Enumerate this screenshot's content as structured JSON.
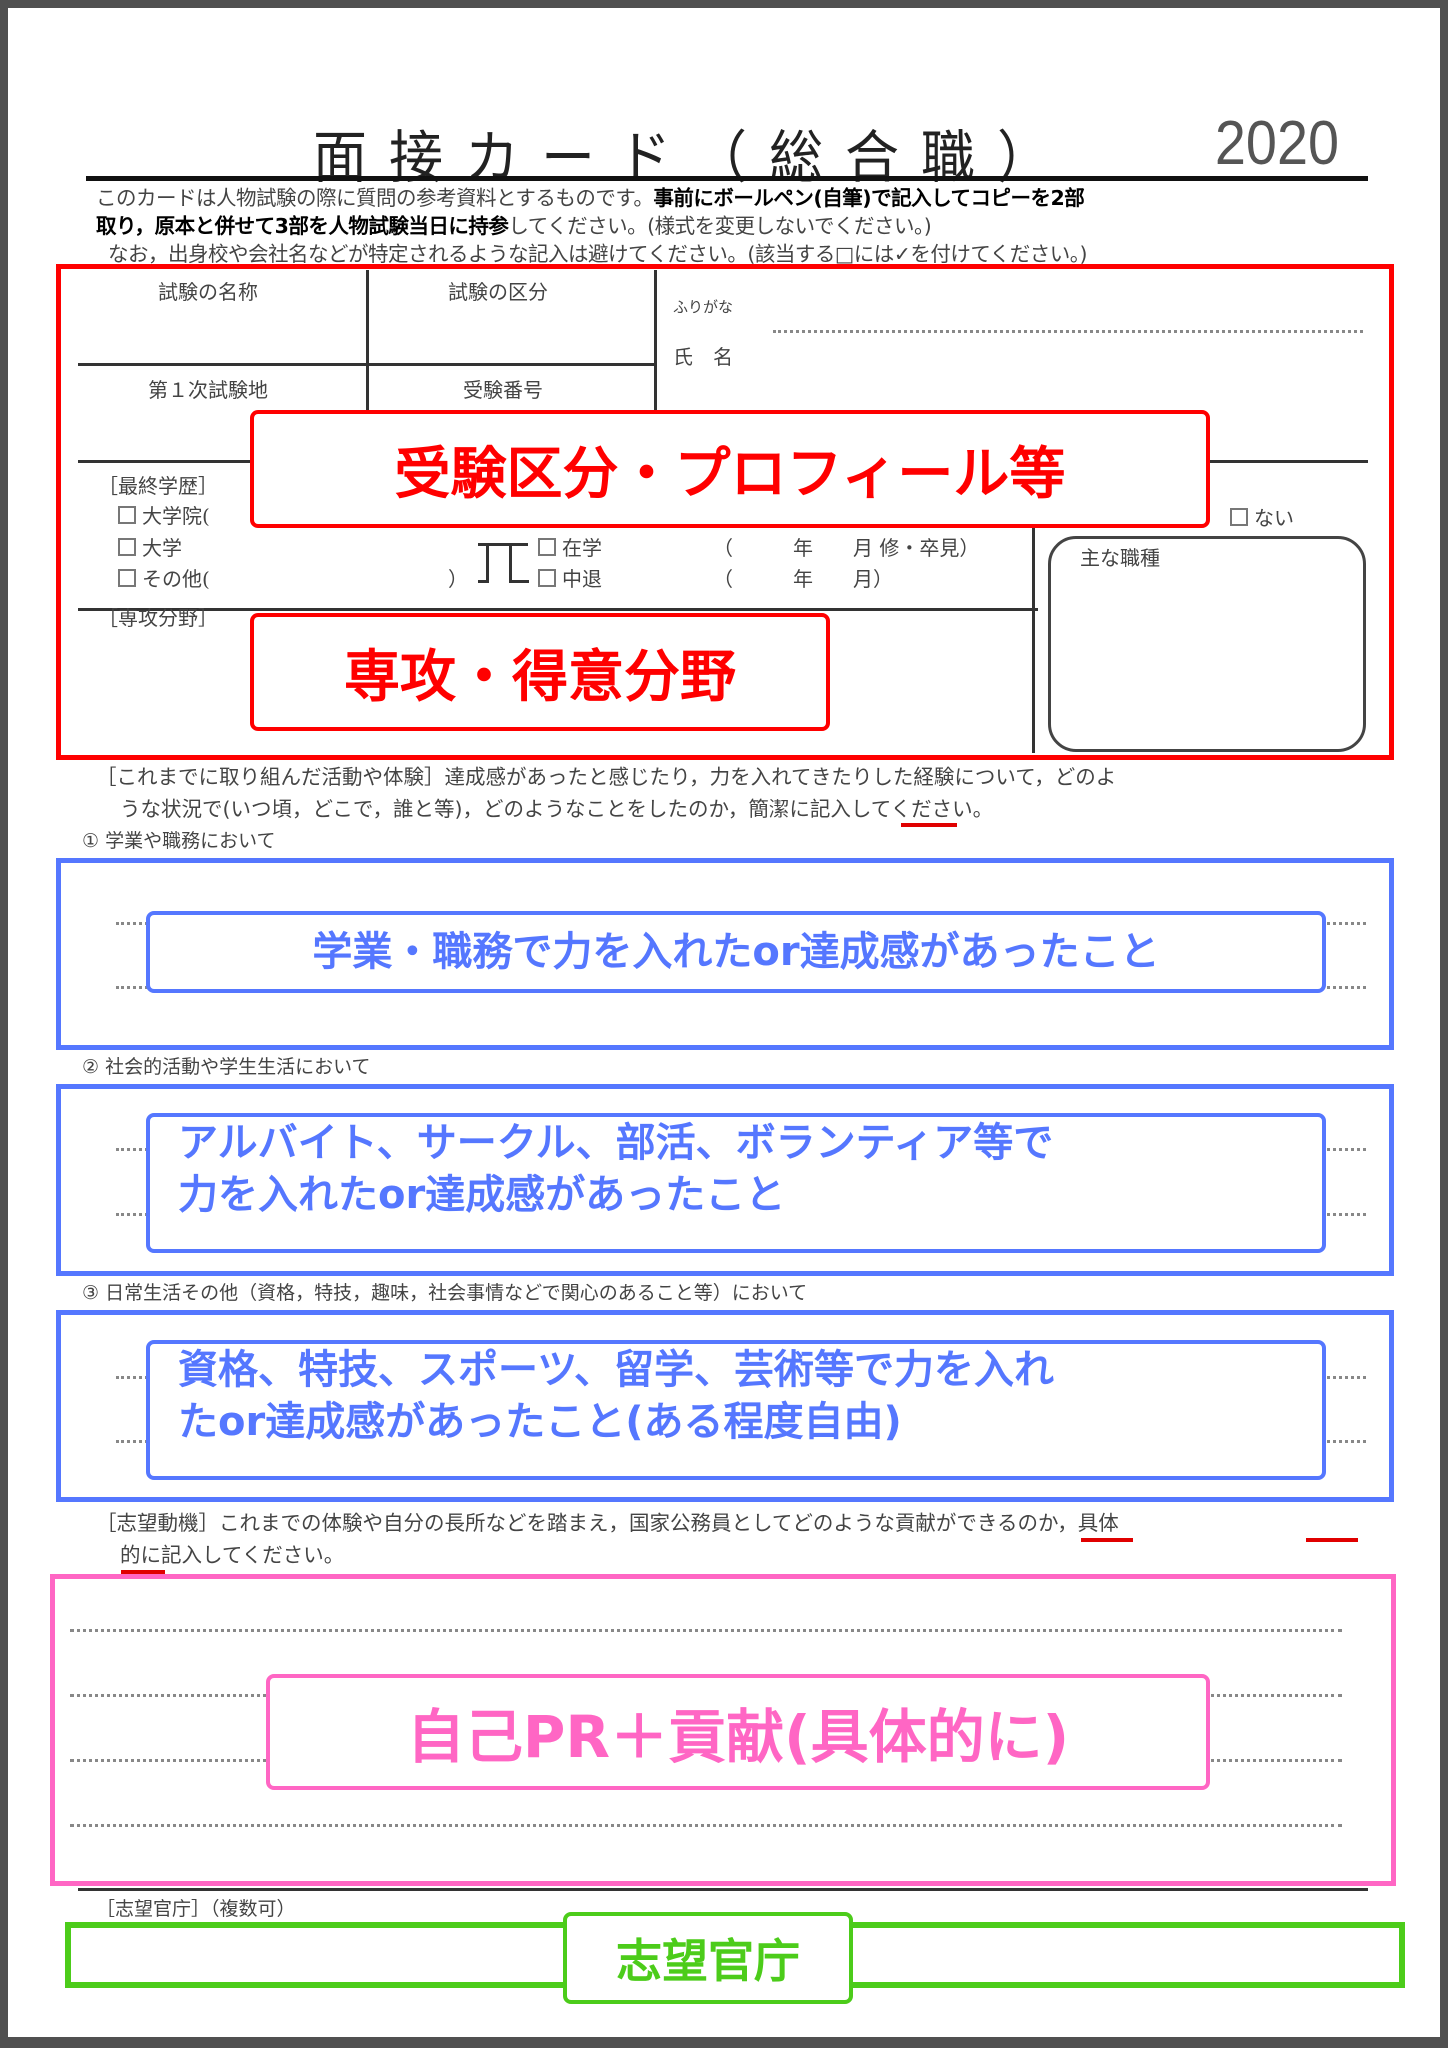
{
  "header": {
    "title": "面接カード（総合職）",
    "year": "2020",
    "intro_line1_normal": "このカードは人物試験の際に質問の参考資料とするものです。",
    "intro_line1_bold": "事前にボールペン(自筆)で記入してコピーを2部",
    "intro_line2_bold": "取り，原本と併せて3部を人物試験当日に持参",
    "intro_line2_normal": "してください。(様式を変更しないでください。)",
    "intro_line3": "なお，出身校や会社名などが特定されるような記入は避けてください。(該当する□には✓を付けてください。)"
  },
  "profile": {
    "exam_name_label": "試験の名称",
    "exam_category_label": "試験の区分",
    "furigana_label": "ふりがな",
    "name_label": "氏　名",
    "first_exam_site_label": "第１次試験地",
    "exam_number_label": "受験番号",
    "education_label": "［最終学歴］",
    "education_options": [
      "大学院(",
      "大学",
      "その他("
    ],
    "other_close": "）",
    "status_options": [
      "在学",
      "中退"
    ],
    "status_row1_suffix": "（　　　年　　月 修・卒見）",
    "status_row2_suffix": "（　　　年　　月）",
    "work_none_label": "ない",
    "main_job_label": "主な職種",
    "major_label": "［専攻分野］"
  },
  "activities": {
    "intro_line1": "［これまでに取り組んだ活動や体験］達成感があったと感じたり，力を入れてきたりした経験について，どのよ",
    "intro_line2_before": "うな状況で(いつ頃，どこで，誰と等)，どのようなことをしたのか，",
    "intro_line2_underlined": "簡潔に",
    "intro_line2_after": "記入してください。",
    "sections": [
      {
        "label": "① 学業や職務において"
      },
      {
        "label": "② 社会的活動や学生生活において"
      },
      {
        "label": "③ 日常生活その他（資格，特技，趣味，社会事情などで関心のあること等）において"
      }
    ]
  },
  "motivation": {
    "line1_before": "［志望動機］これまでの体験や自分の長所などを踏まえ，国家公務員としてどのような",
    "line1_underlined1": "貢献",
    "line1_middle": "ができるのか，",
    "line1_underlined2": "具体",
    "line2_underlined": "的に",
    "line2_after": "記入してください。"
  },
  "ministries": {
    "label": "［志望官庁］（複数可）"
  },
  "annotations": {
    "profile": "受験区分・プロフィール等",
    "major": "専攻・得意分野",
    "section1": "学業・職務で力を入れたor達成感があったこと",
    "section2_line1": "アルバイト、サークル、部活、ボランティア等で",
    "section2_line2": "力を入れたor達成感があったこと",
    "section3_line1": "資格、特技、スポーツ、留学、芸術等で力を入れ",
    "section3_line2": "たor達成感があったこと(ある程度自由)",
    "motivation": "自己PR＋貢献(具体的に)",
    "ministries": "志望官庁"
  },
  "colors": {
    "profile_annotation": "#ff0000",
    "activities_annotation": "#5577ff",
    "motivation_annotation": "#ff66c4",
    "ministries_annotation": "#4ccc1a",
    "frame": "#505050"
  }
}
